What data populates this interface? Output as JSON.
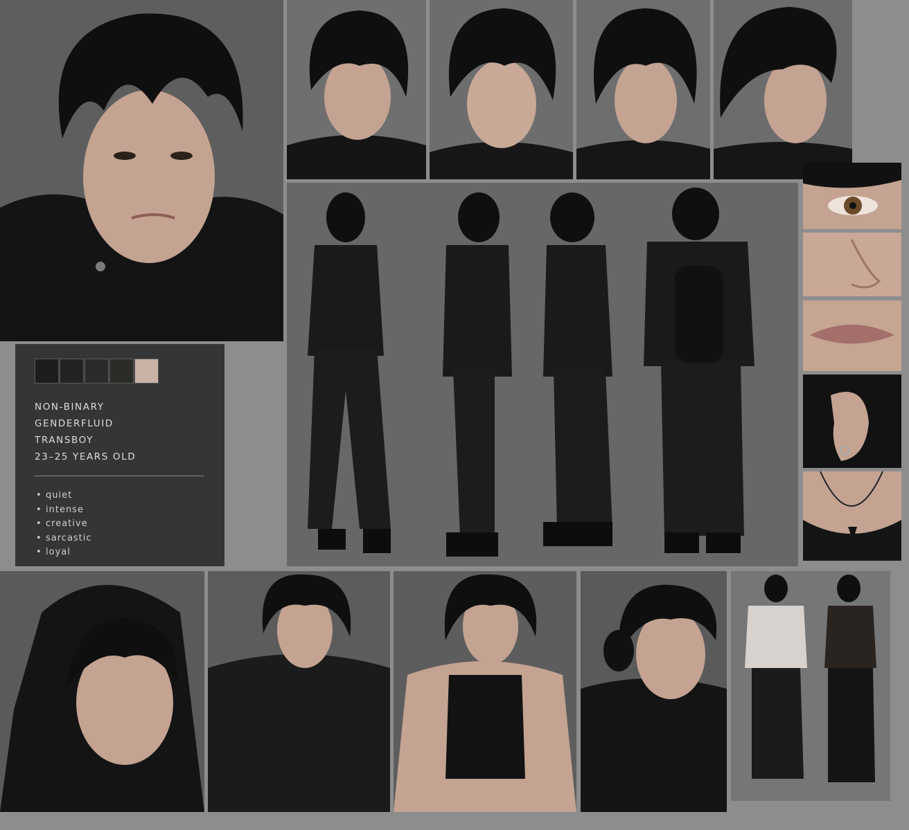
{
  "palette": {
    "swatches": [
      "#1c1c1c",
      "#232323",
      "#2b2b2b",
      "#2a2c25",
      "#c8b2a6"
    ]
  },
  "identity": {
    "traits": [
      "NON-BINARY",
      "GENDERFLUID",
      "TRANSBOY",
      "23–25 YEARS OLD"
    ]
  },
  "personality": {
    "bullet": "•",
    "items": [
      "quiet",
      "intense",
      "creative",
      "sarcastic",
      "loyal"
    ]
  },
  "colors": {
    "background": "#8d8d8d",
    "panel": "#353535",
    "hair": "#0e0e0e",
    "clothing": "#161616",
    "skin": "#c9a896"
  }
}
